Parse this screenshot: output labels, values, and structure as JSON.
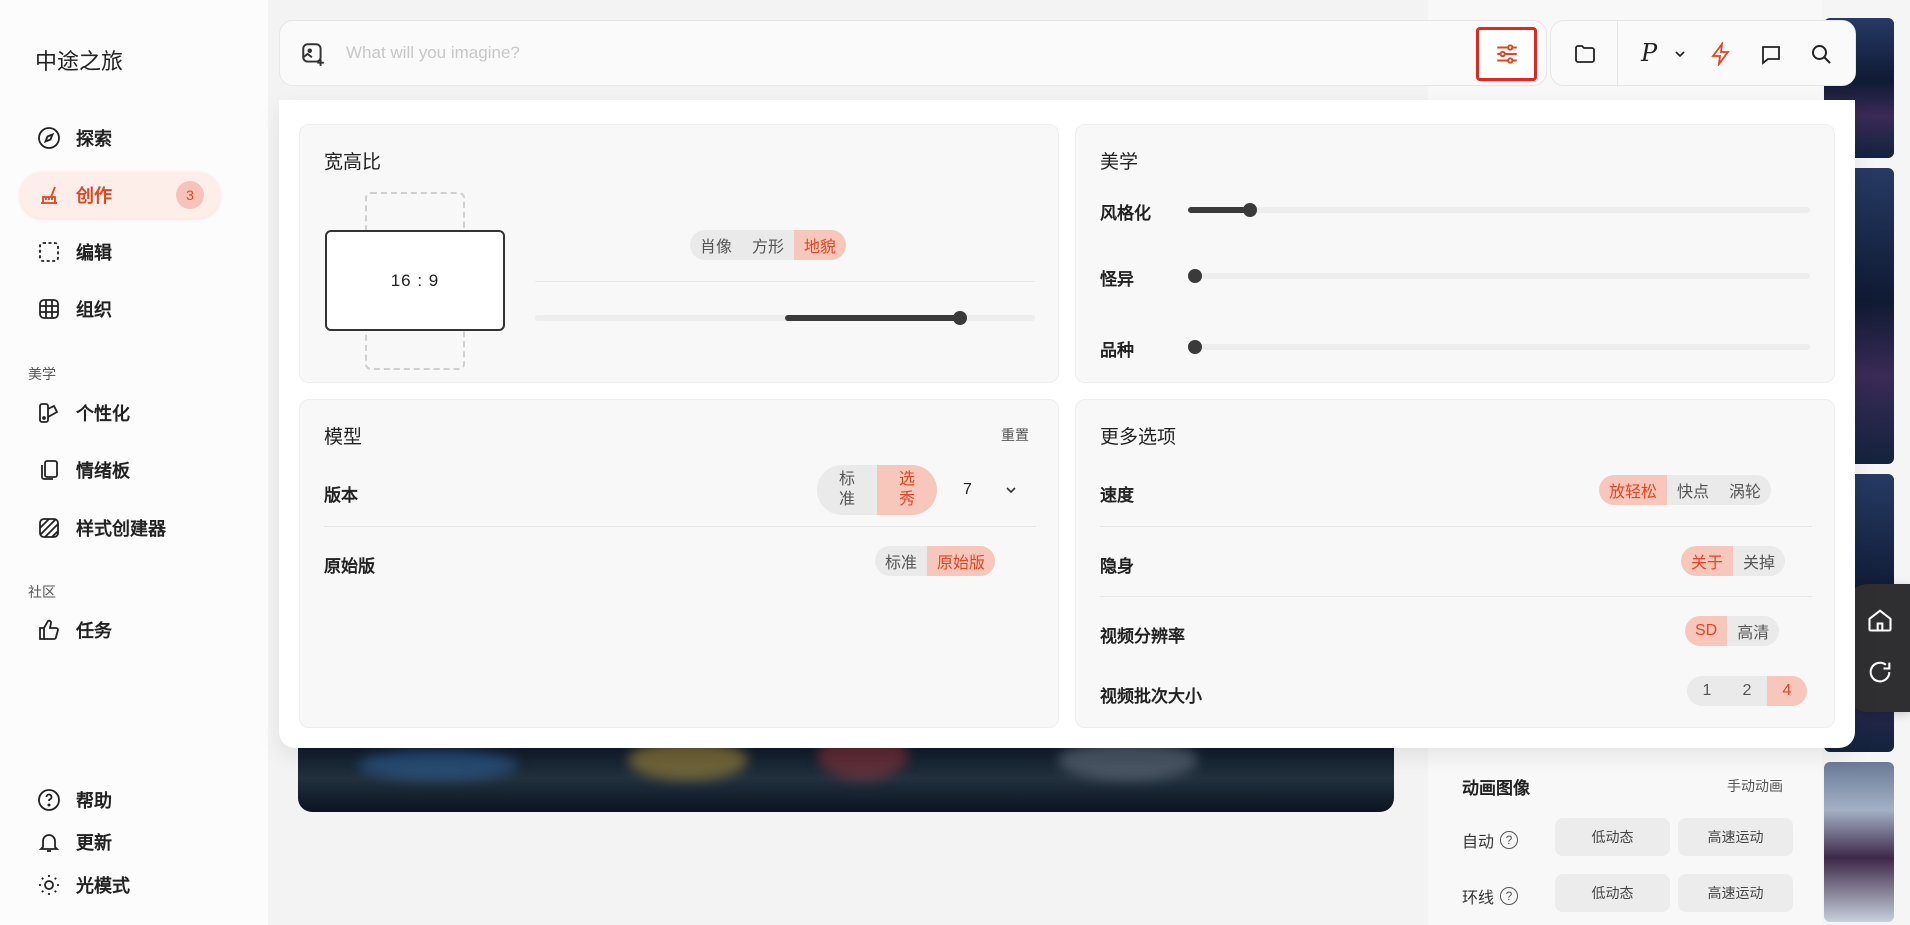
{
  "sidebar": {
    "brand": "中途之旅",
    "items": [
      {
        "label": "探索"
      },
      {
        "label": "创作",
        "badge": "3"
      },
      {
        "label": "编辑"
      },
      {
        "label": "组织"
      }
    ],
    "aesthetics_label": "美学",
    "aesthetics_items": [
      {
        "label": "个性化"
      },
      {
        "label": "情绪板"
      },
      {
        "label": "样式创建器"
      }
    ],
    "community_label": "社区",
    "community_items": [
      {
        "label": "任务"
      }
    ],
    "footer_items": [
      {
        "label": "帮助"
      },
      {
        "label": "更新"
      },
      {
        "label": "光模式"
      }
    ]
  },
  "prompt": {
    "placeholder": "What will you imagine?"
  },
  "toolbar": {
    "profile_letter": "P"
  },
  "aspect": {
    "title": "宽高比",
    "ratio": "16 : 9",
    "options": [
      "肖像",
      "方形",
      "地貌"
    ],
    "selected": "地貌",
    "slider_value": 0.85
  },
  "aesthetics": {
    "title": "美学",
    "rows": [
      {
        "label": "风格化",
        "value": 0.1
      },
      {
        "label": "怪异",
        "value": 0.0
      },
      {
        "label": "品种",
        "value": 0.0
      }
    ]
  },
  "model": {
    "title": "模型",
    "reset": "重置",
    "version_label": "版本",
    "version_options": [
      "标准",
      "选秀"
    ],
    "version_selected": "选秀",
    "version_number": "7",
    "raw_label": "原始版",
    "raw_options": [
      "标准",
      "原始版"
    ],
    "raw_selected": "原始版"
  },
  "more": {
    "title": "更多选项",
    "speed_label": "速度",
    "speed_options": [
      "放轻松",
      "快点",
      "涡轮"
    ],
    "stealth_label": "隐身",
    "stealth_options": [
      "关于",
      "关掉"
    ],
    "video_res_label": "视频分辨率",
    "video_res_options": [
      "SD",
      "高清"
    ],
    "video_batch_label": "视频批次大小",
    "video_batch_options": [
      "1",
      "2",
      "4"
    ]
  },
  "animate": {
    "title": "动画图像",
    "manual": "手动动画",
    "auto_label": "自动",
    "loop_label": "环线",
    "low": "低动态",
    "high": "高速运动"
  },
  "colors": {
    "accent": "#e8431f",
    "highlight_bg": "#f7c7bc",
    "settings_border": "#e5261c"
  }
}
